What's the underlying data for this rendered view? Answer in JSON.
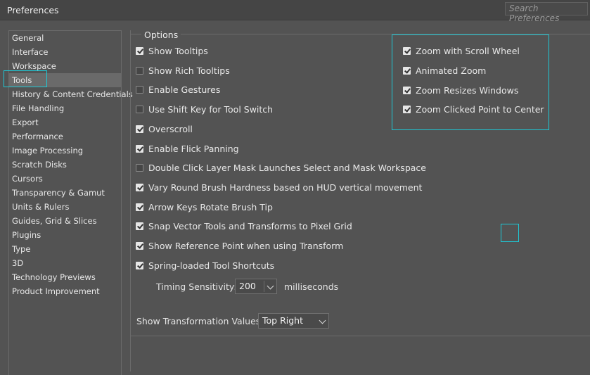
{
  "window": {
    "title": "Preferences"
  },
  "search": {
    "placeholder": "Search Preferences"
  },
  "sidebar": {
    "selected": "Tools",
    "items": [
      {
        "label": "General"
      },
      {
        "label": "Interface"
      },
      {
        "label": "Workspace"
      },
      {
        "label": "Tools"
      },
      {
        "label": "History & Content Credentials"
      },
      {
        "label": "File Handling"
      },
      {
        "label": "Export"
      },
      {
        "label": "Performance"
      },
      {
        "label": "Image Processing"
      },
      {
        "label": "Scratch Disks"
      },
      {
        "label": "Cursors"
      },
      {
        "label": "Transparency & Gamut"
      },
      {
        "label": "Units & Rulers"
      },
      {
        "label": "Guides, Grid & Slices"
      },
      {
        "label": "Plugins"
      },
      {
        "label": "Type"
      },
      {
        "label": "3D"
      },
      {
        "label": "Technology Previews"
      },
      {
        "label": "Product Improvement"
      }
    ]
  },
  "options": {
    "legend": "Options",
    "left": [
      {
        "label": "Show Tooltips",
        "checked": true
      },
      {
        "label": "Show Rich Tooltips",
        "checked": false
      },
      {
        "label": "Enable Gestures",
        "checked": false
      },
      {
        "label": "Use Shift Key for Tool Switch",
        "checked": false
      },
      {
        "label": "Overscroll",
        "checked": true
      },
      {
        "label": "Enable Flick Panning",
        "checked": true
      },
      {
        "label": "Double Click Layer Mask Launches Select and Mask Workspace",
        "checked": false
      },
      {
        "label": "Vary Round Brush Hardness based on HUD vertical movement",
        "checked": true
      },
      {
        "label": "Arrow Keys Rotate Brush Tip",
        "checked": true
      },
      {
        "label": "Snap Vector Tools and Transforms to Pixel Grid",
        "checked": true
      },
      {
        "label": "Show Reference Point when using Transform",
        "checked": true
      },
      {
        "label": "Spring-loaded Tool Shortcuts",
        "checked": true
      }
    ],
    "right": [
      {
        "label": "Zoom with Scroll Wheel",
        "checked": true
      },
      {
        "label": "Animated Zoom",
        "checked": true
      },
      {
        "label": "Zoom Resizes Windows",
        "checked": true
      },
      {
        "label": "Zoom Clicked Point to Center",
        "checked": true
      }
    ],
    "timing": {
      "label": "Timing Sensitivity:",
      "value": "200",
      "unit": "milliseconds"
    },
    "transform_values": {
      "label": "Show Transformation Values:",
      "value": "Top Right"
    }
  },
  "colors": {
    "highlight": "#1ec9d6",
    "background": "#535353",
    "selected_item": "#6a6a6a"
  }
}
